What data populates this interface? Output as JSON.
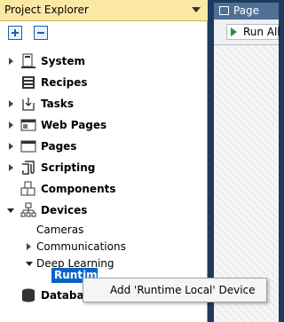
{
  "explorer": {
    "title": "Project Explorer",
    "toolbar": {
      "expand_icon": "plus-square-icon",
      "collapse_icon": "minus-square-icon"
    },
    "items": [
      {
        "label": "System",
        "icon": "computer-icon",
        "expandable": true,
        "expanded": false
      },
      {
        "label": "Recipes",
        "icon": "recipe-book-icon",
        "expandable": false
      },
      {
        "label": "Tasks",
        "icon": "tasks-icon",
        "expandable": true,
        "expanded": false
      },
      {
        "label": "Web Pages",
        "icon": "web-page-icon",
        "expandable": true,
        "expanded": false
      },
      {
        "label": "Pages",
        "icon": "page-icon",
        "expandable": true,
        "expanded": false
      },
      {
        "label": "Scripting",
        "icon": "script-icon",
        "expandable": true,
        "expanded": false
      },
      {
        "label": "Components",
        "icon": "components-icon",
        "expandable": false
      },
      {
        "label": "Devices",
        "icon": "devices-icon",
        "expandable": true,
        "expanded": true
      },
      {
        "label": "Cameras"
      },
      {
        "label": "Communications"
      },
      {
        "label": "Deep Learning"
      },
      {
        "label": "Runtime"
      },
      {
        "label": "Database",
        "icon": "database-icon"
      }
    ]
  },
  "page_tab": {
    "label": "Page",
    "run_all": "Run All"
  },
  "context_menu": {
    "item": "Add 'Runtime Local' Device"
  },
  "colors": {
    "title_bg": "#fce8a5",
    "selection": "#0a64c8",
    "tab_bg": "#4f6f95",
    "frame_bg": "#1f3a5f"
  }
}
